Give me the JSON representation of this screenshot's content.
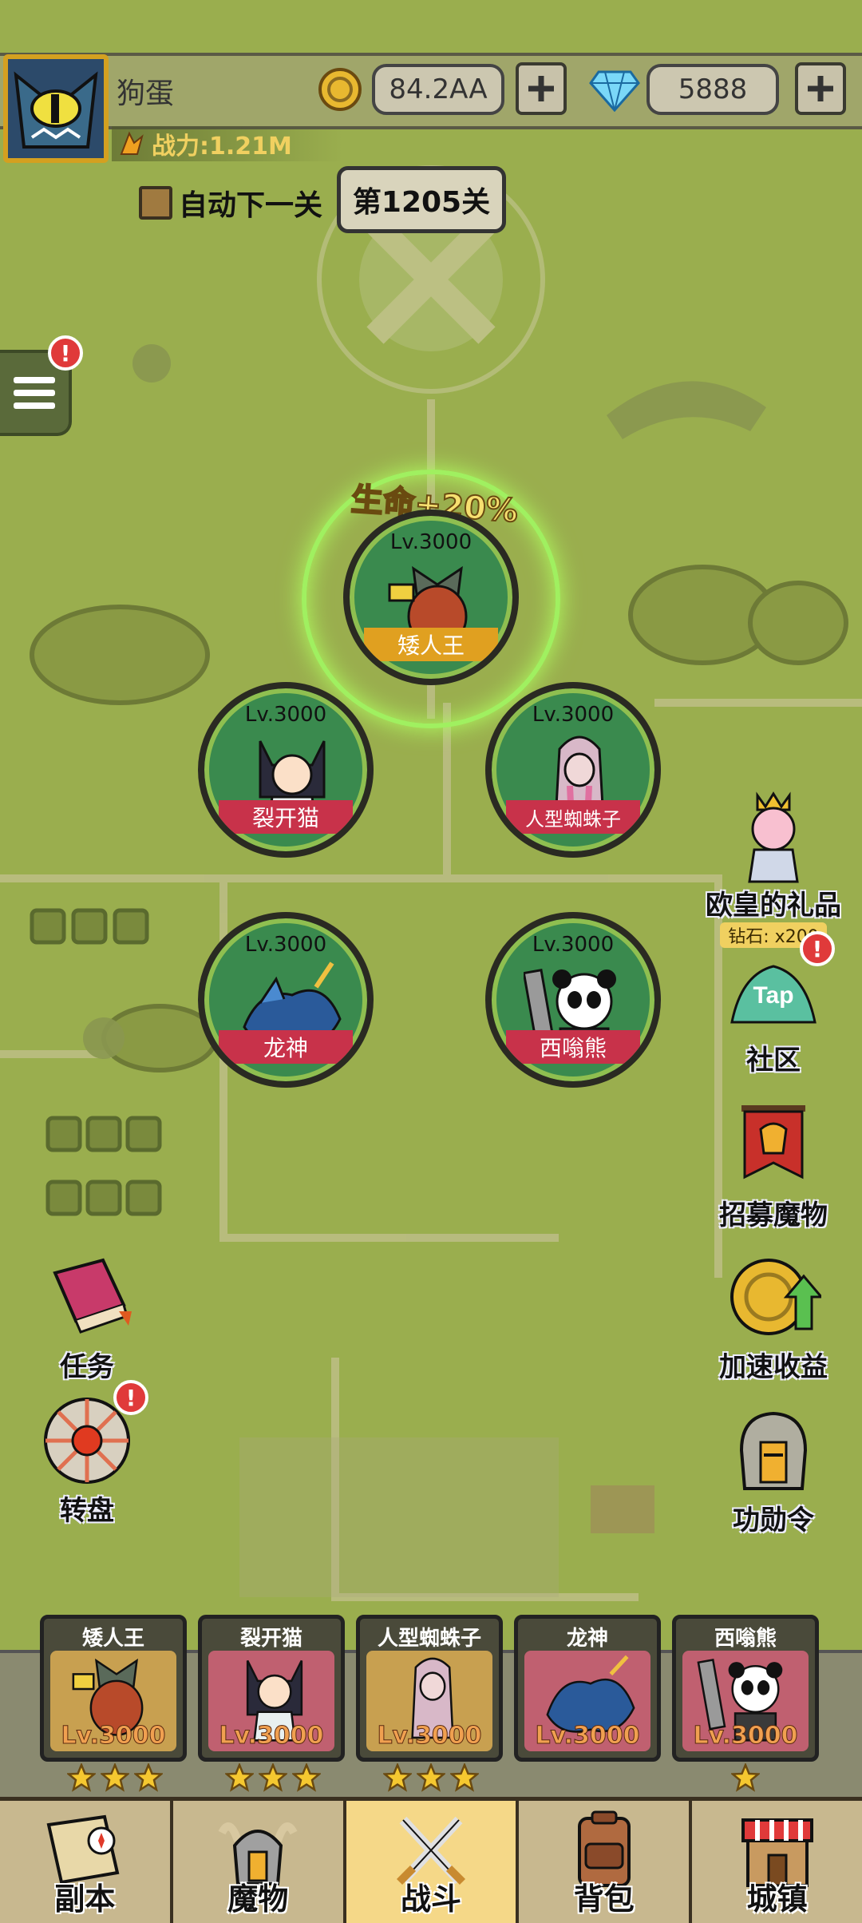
{
  "player": {
    "name": "狗蛋",
    "power": "战力:1.21M"
  },
  "resources": {
    "coins": "84.2AA",
    "gems": "5888"
  },
  "battle": {
    "auto_next_label": "自动下一关",
    "stage": "第1205关",
    "buff_text": "生命+20%"
  },
  "heroes": [
    {
      "level": "Lv.3000",
      "name": "矮人王"
    },
    {
      "level": "Lv.3000",
      "name": "裂开猫"
    },
    {
      "level": "Lv.3000",
      "name": "人型蜘蛛子"
    },
    {
      "level": "Lv.3000",
      "name": "龙神"
    },
    {
      "level": "Lv.3000",
      "name": "西嗡熊"
    }
  ],
  "side_features": {
    "gift": {
      "label": "欧皇的礼品",
      "sub": "钻石: x200"
    },
    "community": {
      "label": "社区",
      "tap": "Tap"
    },
    "recruit": {
      "label": "招募魔物"
    },
    "boost": {
      "label": "加速收益"
    },
    "merit": {
      "label": "功勋令"
    },
    "tasks": {
      "label": "任务"
    },
    "wheel": {
      "label": "转盘"
    }
  },
  "team": [
    {
      "name": "矮人王",
      "level": "Lv.3000",
      "stars": 3
    },
    {
      "name": "裂开猫",
      "level": "Lv.3000",
      "stars": 3
    },
    {
      "name": "人型蜘蛛子",
      "level": "Lv.3000",
      "stars": 3
    },
    {
      "name": "龙神",
      "level": "Lv.3000",
      "stars": 0
    },
    {
      "name": "西嗡熊",
      "level": "Lv.3000",
      "stars": 1
    }
  ],
  "nav": {
    "dungeon": "副本",
    "monsters": "魔物",
    "battle": "战斗",
    "bag": "背包",
    "town": "城镇"
  },
  "badges": {
    "alert": "!"
  },
  "colors": {
    "map_green": "#9aae4e",
    "nav_active": "#f5d888",
    "ribbon_red": "#c8324a",
    "ribbon_gold": "#e0a020"
  }
}
